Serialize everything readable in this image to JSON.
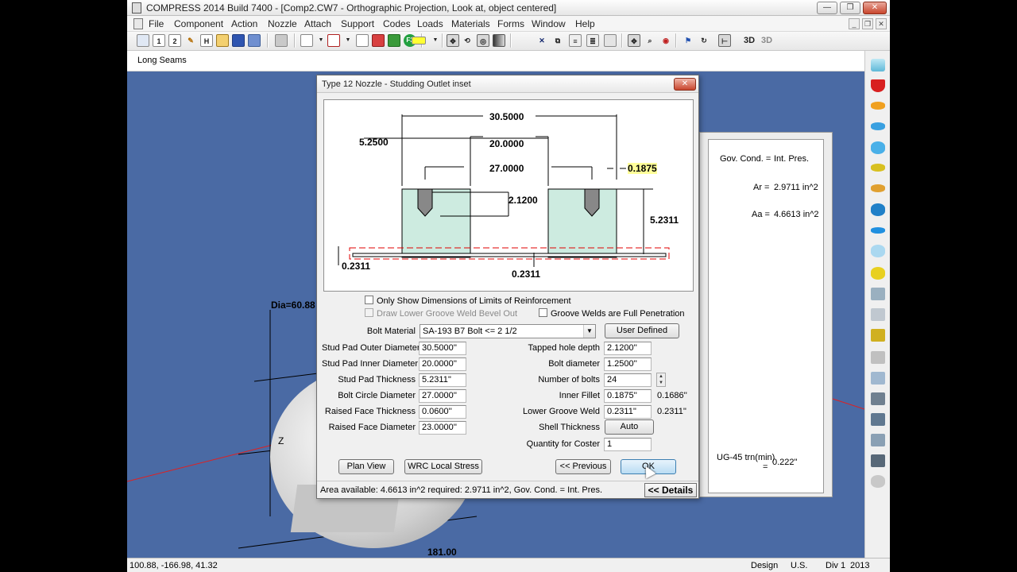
{
  "window": {
    "title": "COMPRESS 2014 Build 7400 - [Comp2.CW7 - Orthographic Projection, Look at, object centered]",
    "minimize_glyph": "—",
    "restore_glyph": "❐",
    "close_glyph": "✕"
  },
  "menubar": {
    "items": [
      "File",
      "Component",
      "Action",
      "Nozzle",
      "Attach",
      "Support",
      "Codes",
      "Loads",
      "Materials",
      "Forms",
      "Window",
      "Help"
    ],
    "mdi_minimize": "_",
    "mdi_restore": "❐",
    "mdi_close": "✕"
  },
  "toolbar": {
    "btn_1": "1",
    "btn_2": "2",
    "btn_h": "H",
    "btn_f3": "F3",
    "btn_3d": "3D",
    "btn_3d_dim": "3D"
  },
  "header_strip": {
    "label": "Long Seams"
  },
  "viewport": {
    "dia_label": "Dia=60.88",
    "z_label": "Z",
    "bottom_label": "181.00"
  },
  "summary_panel": {
    "gov_cond": "Gov. Cond. =",
    "gov_cond_value": "Int. Pres.",
    "ar_label": "Ar =",
    "ar_value": "2.9711 in^2",
    "aa_label": "Aa =",
    "aa_value": "4.6613 in^2",
    "ug45_label": "UG-45 trn(min)",
    "ug45_eq": "=",
    "ug45_value": "0.222\""
  },
  "dialog": {
    "title": "Type 12 Nozzle - Studding Outlet inset",
    "close_glyph": "✕",
    "drawing": {
      "dim_30_5": "30.5000",
      "dim_5_25": "5.2500",
      "dim_20": "20.0000",
      "dim_27": "27.0000",
      "dim_0_1875": "0.1875",
      "dim_2_12": "2.1200",
      "dim_5_2311": "5.2311",
      "dim_0_2311_left": "0.2311",
      "dim_0_2311_bottom": "0.2311"
    },
    "checkboxes": {
      "only_limits": "Only Show Dimensions of Limits of Reinforcement",
      "draw_groove": "Draw Lower Groove Weld Bevel Out",
      "groove_full": "Groove Welds are Full Penetration"
    },
    "bolt_material_label": "Bolt Material",
    "bolt_material_value": "SA-193 B7 Bolt <= 2 1/2",
    "dropdown_arrow": "▼",
    "user_defined_button": "User Defined",
    "left_fields": [
      {
        "label": "Stud Pad Outer Diameter",
        "value": "30.5000''"
      },
      {
        "label": "Stud Pad Inner Diameter",
        "value": "20.0000''"
      },
      {
        "label": "Stud Pad Thickness",
        "value": "5.2311''"
      },
      {
        "label": "Bolt Circle Diameter",
        "value": "27.0000''"
      },
      {
        "label": "Raised Face Thickness",
        "value": "0.0600''"
      },
      {
        "label": "Raised Face Diameter",
        "value": "23.0000''"
      }
    ],
    "right_fields": [
      {
        "label": "Tapped hole depth",
        "value": "2.1200''"
      },
      {
        "label": "Bolt diameter",
        "value": "1.2500''"
      },
      {
        "label": "Number of bolts",
        "value": "24"
      },
      {
        "label": "Inner Fillet",
        "value": "0.1875''",
        "extra": "0.1686''"
      },
      {
        "label": "Lower Groove Weld",
        "value": "0.2311''",
        "extra": "0.2311''"
      }
    ],
    "shell_thickness_label": "Shell Thickness",
    "shell_thickness_button": "Auto",
    "quantity_label": "Quantity for Coster",
    "quantity_value": "1",
    "spin_up": "▲",
    "spin_down": "▼",
    "plan_view_button": "Plan View",
    "wrc_button": "WRC Local Stress",
    "previous_button": "<< Previous",
    "ok_button": "OK",
    "status_text": "Area available: 4.6613 in^2    required: 2.9711 in^2, Gov. Cond. = Int. Pres.",
    "details_button": "<< Details"
  },
  "statusbar": {
    "coords": "100.88, -166.98, 41.32",
    "mode": "Design",
    "units": "U.S.",
    "division": "Div 1",
    "year": "2013"
  },
  "colors": {
    "viewport_bg": "#4a6aa4",
    "pad_fill": "#cdebe0",
    "highlight": "#ffff99",
    "limit_dash": "#e00000"
  }
}
